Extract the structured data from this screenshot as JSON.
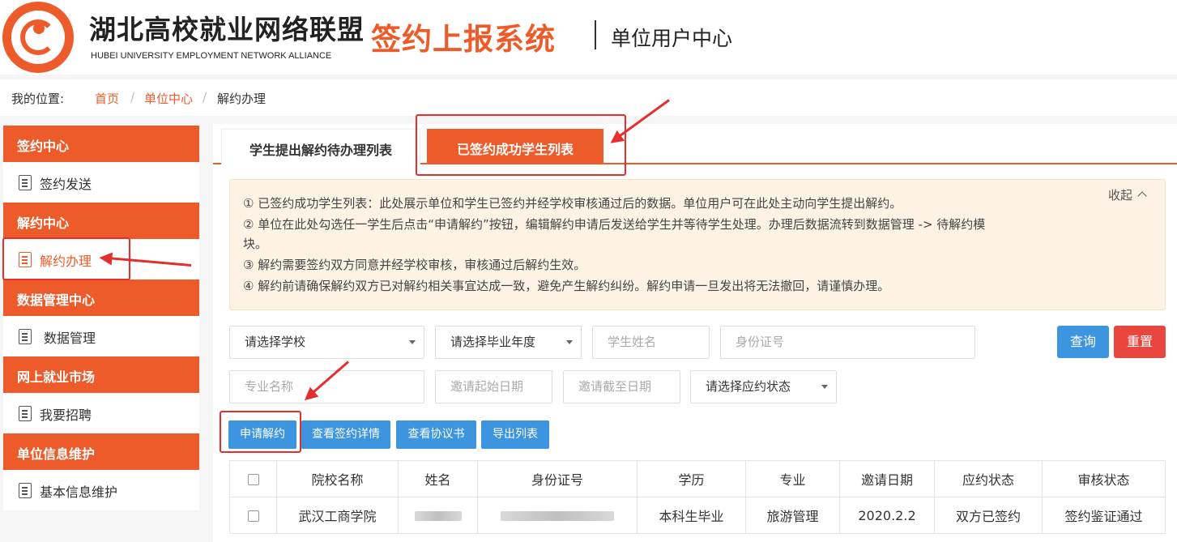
{
  "header": {
    "org_name": "湖北高校就业网络联盟",
    "org_en": "HUBEI UNIVERSITY EMPLOYMENT NETWORK ALLIANCE",
    "system_name": "签约上报系统",
    "sub_title": "单位用户中心"
  },
  "breadcrumb": {
    "label": "我的位置:",
    "home": "首页",
    "sep": "/",
    "unit_center": "单位中心",
    "current": "解约办理"
  },
  "sidebar": {
    "sections": [
      {
        "title": "签约中心",
        "items": [
          "签约发送"
        ]
      },
      {
        "title": "解约中心",
        "items": [
          "解约办理"
        ]
      },
      {
        "title": "数据管理中心",
        "items": [
          "数据管理"
        ]
      },
      {
        "title": "网上就业市场",
        "items": [
          "我要招聘"
        ]
      },
      {
        "title": "单位信息维护",
        "items": [
          "基本信息维护"
        ]
      }
    ],
    "active_item": "解约办理"
  },
  "tabs": [
    "学生提出解约待办理列表",
    "已签约成功学生列表"
  ],
  "active_tab": "已签约成功学生列表",
  "notice": {
    "collapse_label": "收起",
    "lines": [
      "① 已签约成功学生列表：此处展示单位和学生已签约并经学校审核通过后的数据。单位用户可在此处主动向学生提出解约。",
      "② 单位在此处勾选任一学生后点击“申请解约”按钮，编辑解约申请后发送给学生并等待学生处理。办理后数据流转到数据管理 -> 待解约模",
      "块。",
      "③ 解约需要签约双方同意并经学校审核，审核通过后解约生效。",
      "④ 解约前请确保解约双方已对解约相关事宜达成一致，避免产生解约纠纷。解约申请一旦发出将无法撤回，请谨慎办理。"
    ]
  },
  "filters": {
    "school_select": "请选择学校",
    "year_select": "请选择毕业年度",
    "name_placeholder": "学生姓名",
    "id_placeholder": "身份证号",
    "major_placeholder": "专业名称",
    "start_date_placeholder": "邀请起始日期",
    "end_date_placeholder": "邀请截至日期",
    "status_select": "请选择应约状态",
    "query_button": "查询",
    "reset_button": "重置"
  },
  "actions": [
    "申请解约",
    "查看签约详情",
    "查看协议书",
    "导出列表"
  ],
  "table": {
    "columns": [
      "院校名称",
      "姓名",
      "身份证号",
      "学历",
      "专业",
      "邀请日期",
      "应约状态",
      "审核状态"
    ],
    "rows": [
      {
        "school": "武汉工商学院",
        "degree": "本科生毕业",
        "major": "旅游管理",
        "invite_date": "2020.2.2",
        "accept_status": "双方已签约",
        "review_status": "签约鉴证通过"
      }
    ]
  },
  "colors": {
    "brand": "#ed5b2a",
    "button_blue": "#3d95e0",
    "button_red": "#e9463f",
    "status_green": "#3aa13a",
    "annotation_red": "#e52f2f"
  }
}
